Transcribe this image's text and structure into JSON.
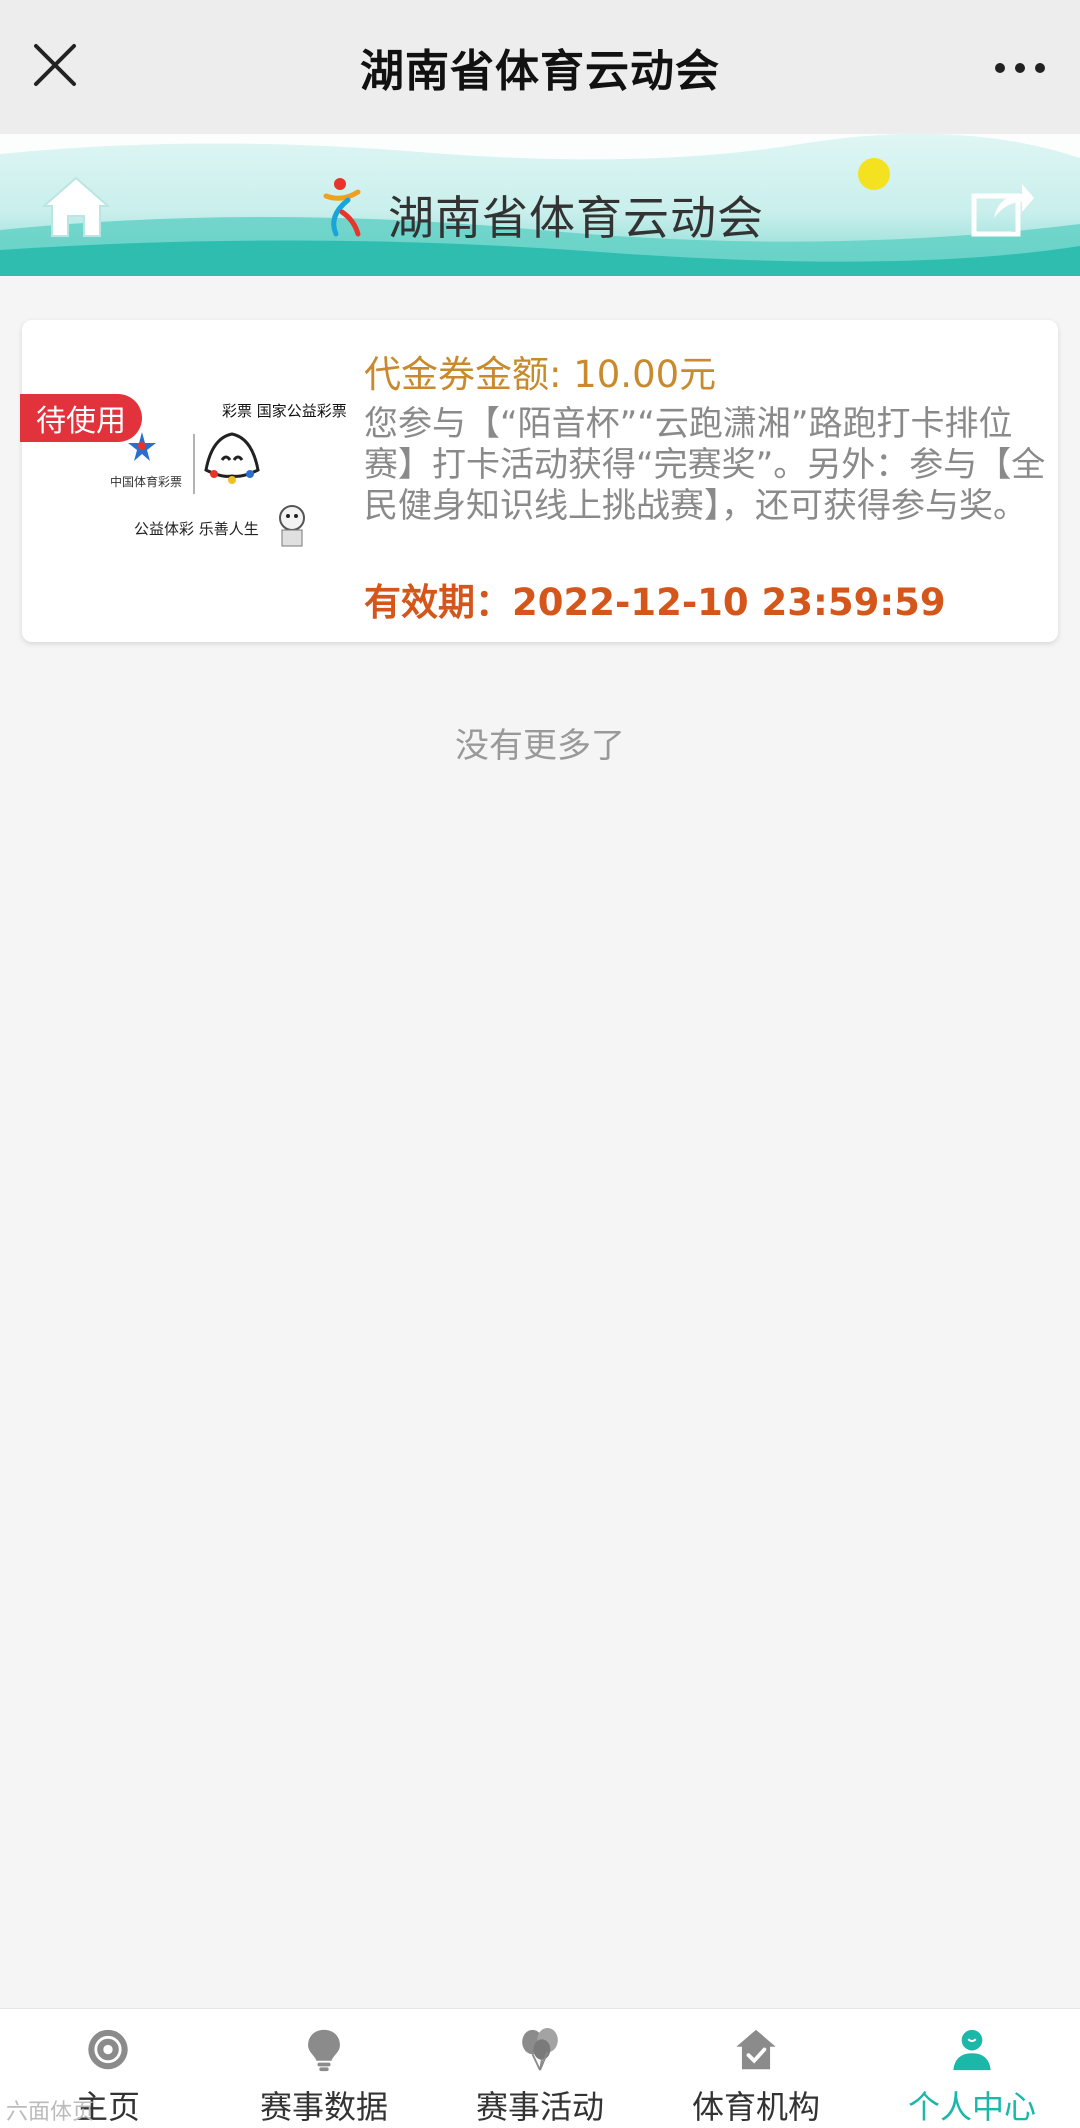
{
  "titlebar": {
    "title": "湖南省体育云动会"
  },
  "banner": {
    "title": "湖南省体育云动会"
  },
  "voucher": {
    "status_badge": "待使用",
    "amount": "代金券金额: 10.00元",
    "description": "您参与【“陌音杯”“云跑潇湘”路跑打卡排位赛】打卡活动获得“完赛奖”。另外：参与【全民健身知识线上挑战赛】，还可获得参与奖。",
    "validity": "有效期：2022-12-10 23:59:59",
    "thumb_top_text": "彩票  国家公益彩票",
    "thumb_logo_text": "中国体育彩票",
    "thumb_slogan": "公益体彩 乐善人生"
  },
  "no_more": "没有更多了",
  "tabbar": {
    "items": [
      {
        "label": "主页",
        "icon": "target-icon"
      },
      {
        "label": "赛事数据",
        "icon": "lightbulb-icon"
      },
      {
        "label": "赛事活动",
        "icon": "balloons-icon"
      },
      {
        "label": "体育机构",
        "icon": "house-check-icon"
      },
      {
        "label": "个人中心",
        "icon": "person-icon"
      }
    ],
    "active_index": 4
  },
  "watermark": "六面体页",
  "colors": {
    "accent": "#1bb7a9",
    "badge": "#e2323b",
    "amount": "#c88a2d",
    "validity": "#d4561a"
  }
}
